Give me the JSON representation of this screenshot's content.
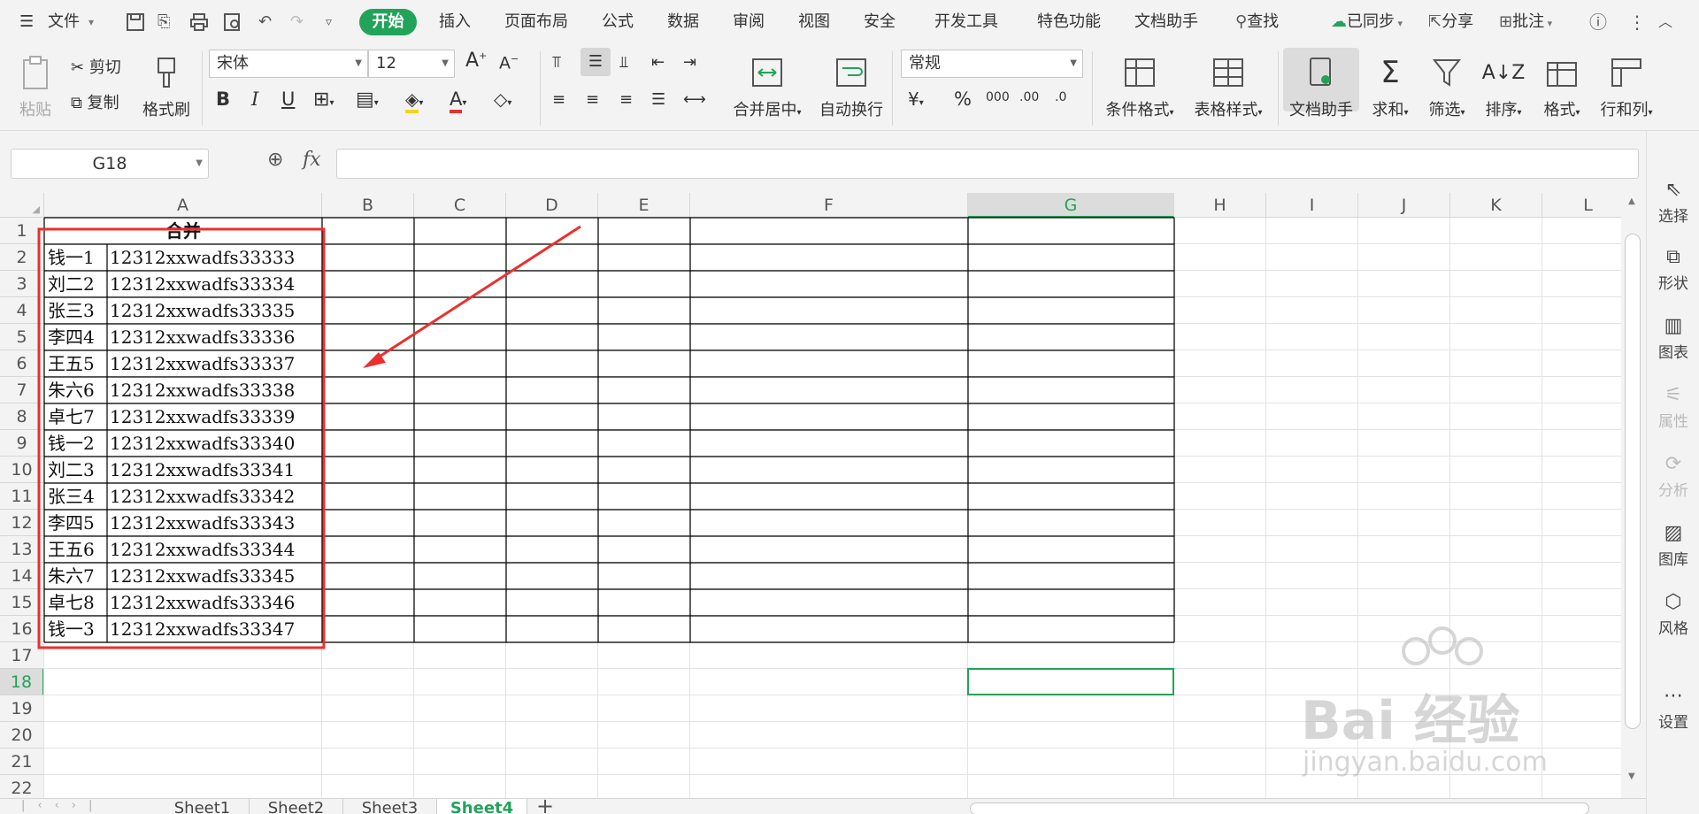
{
  "menu": {
    "file": "文件",
    "start": "开始",
    "insert": "插入",
    "page_layout": "页面布局",
    "formula": "公式",
    "data": "数据",
    "review": "审阅",
    "view": "视图",
    "security": "安全",
    "dev_tools": "开发工具",
    "special": "特色功能",
    "doc_helper": "文档助手",
    "find": "查找",
    "synced": "已同步",
    "share": "分享",
    "annotate": "批注"
  },
  "ribbon": {
    "paste": "粘贴",
    "cut": "剪切",
    "copy": "复制",
    "format_painter": "格式刷",
    "font": "宋体",
    "font_size": "12",
    "merge_center": "合并居中",
    "auto_wrap": "自动换行",
    "number_format": "常规",
    "cond_format": "条件格式",
    "table_style": "表格样式",
    "doc_helper": "文档助手",
    "sum": "求和",
    "filter": "筛选",
    "sort": "排序",
    "format": "格式",
    "row_col": "行和列",
    "bold": "B",
    "italic": "I",
    "underline": "U",
    "percent": "%",
    "thousands": "000",
    "dec_inc": ".00",
    "dec_dec": ".0",
    "font_grow": "A",
    "font_shrink": "A",
    "font_color": "A"
  },
  "formula_bar": {
    "name_box": "G18",
    "fx": "fx",
    "value": ""
  },
  "right_panel": {
    "select": "选择",
    "shape": "形状",
    "chart": "图表",
    "property": "属性",
    "analysis": "分析",
    "gallery": "图库",
    "style": "风格",
    "settings": "设置"
  },
  "sheet": {
    "columns": [
      "A",
      "B",
      "C",
      "D",
      "E",
      "F",
      "G",
      "H",
      "I",
      "J",
      "K",
      "L"
    ],
    "rows": [
      "1",
      "2",
      "3",
      "4",
      "5",
      "6",
      "7",
      "8",
      "9",
      "10",
      "11",
      "12",
      "13",
      "14",
      "15",
      "16",
      "17",
      "18",
      "19",
      "20",
      "21",
      "22"
    ],
    "header_cell": "合并",
    "data": [
      [
        "钱一1",
        "12312xxwadfs33333"
      ],
      [
        "刘二2",
        "12312xxwadfs33334"
      ],
      [
        "张三3",
        "12312xxwadfs33335"
      ],
      [
        "李四4",
        "12312xxwadfs33336"
      ],
      [
        "王五5",
        "12312xxwadfs33337"
      ],
      [
        "朱六6",
        "12312xxwadfs33338"
      ],
      [
        "卓七7",
        "12312xxwadfs33339"
      ],
      [
        "钱一2",
        "12312xxwadfs33340"
      ],
      [
        "刘二3",
        "12312xxwadfs33341"
      ],
      [
        "张三4",
        "12312xxwadfs33342"
      ],
      [
        "李四5",
        "12312xxwadfs33343"
      ],
      [
        "王五6",
        "12312xxwadfs33344"
      ],
      [
        "朱六7",
        "12312xxwadfs33345"
      ],
      [
        "卓七8",
        "12312xxwadfs33346"
      ],
      [
        "钱一3",
        "12312xxwadfs33347"
      ]
    ],
    "selected_cell": "G18"
  },
  "tabs": {
    "items": [
      "Sheet1",
      "Sheet2",
      "Sheet3",
      "Sheet4"
    ],
    "active": "Sheet4"
  },
  "watermark": {
    "brand": "Bai  经验",
    "url": "jingyan.baidu.com"
  },
  "colors": {
    "accent": "#22a35a",
    "annotation": "#e8312f",
    "grid_line": "#e3e3e3",
    "border": "#000000"
  }
}
